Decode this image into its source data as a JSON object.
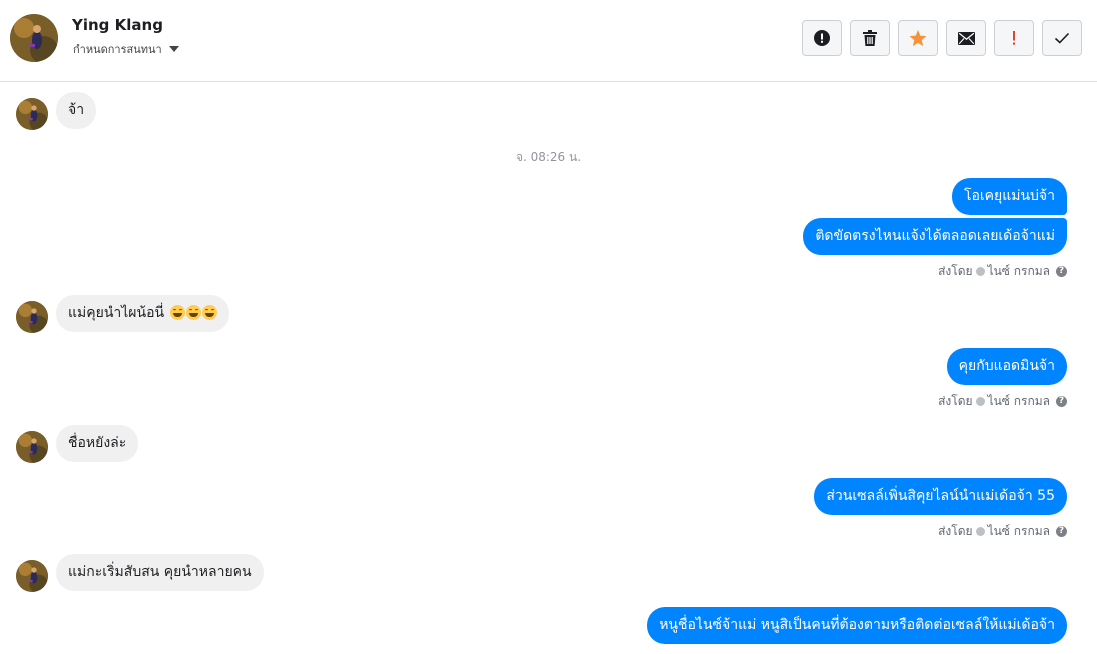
{
  "header": {
    "contact_name": "Ying Klang",
    "assign_label": "กำหนดการสนทนา",
    "actions": [
      {
        "name": "mark-spam-button",
        "icon": "alert-circle-icon"
      },
      {
        "name": "delete-button",
        "icon": "trash-icon"
      },
      {
        "name": "star-button",
        "icon": "star-icon"
      },
      {
        "name": "mark-unread-button",
        "icon": "envelope-icon"
      },
      {
        "name": "follow-up-button",
        "icon": "exclamation-icon"
      },
      {
        "name": "mark-done-button",
        "icon": "checkmark-icon"
      }
    ]
  },
  "colors": {
    "outgoing_bubble": "#0084ff",
    "incoming_bubble": "#f1f0f0",
    "star": "#f7923a",
    "follow_up": "#e0442f"
  },
  "messages": {
    "m1": "จ้า",
    "timestamp": "จ. 08:26 น.",
    "m2": "โอเคยุแม่นบ่จ้า",
    "m3": "ติดขัดตรงไหนแจ้งได้ตลอดเลยเด้อจ้าแม่",
    "m4": "แม่คุยนำไผน้อนี่",
    "m5": "คุยกับแอดมินจ้า",
    "m6": "ชื่อหยังล่ะ",
    "m7": "ส่วนเซลล์เพิ่นสิคุยไลน์นำแม่เด้อจ้า 55",
    "m8": "แม่กะเริ่มสับสน คุยนำหลายคน",
    "m9": "หนูชื่อไนซ์จ้าแม่ หนูสิเป็นคนที่ต้องตามหรือติดต่อเซลล์ให้แม่เด้อจ้า"
  },
  "sent_by": {
    "prefix": "ส่งโดย",
    "agent": "ไนซ์ กรกมล",
    "help": "?"
  }
}
